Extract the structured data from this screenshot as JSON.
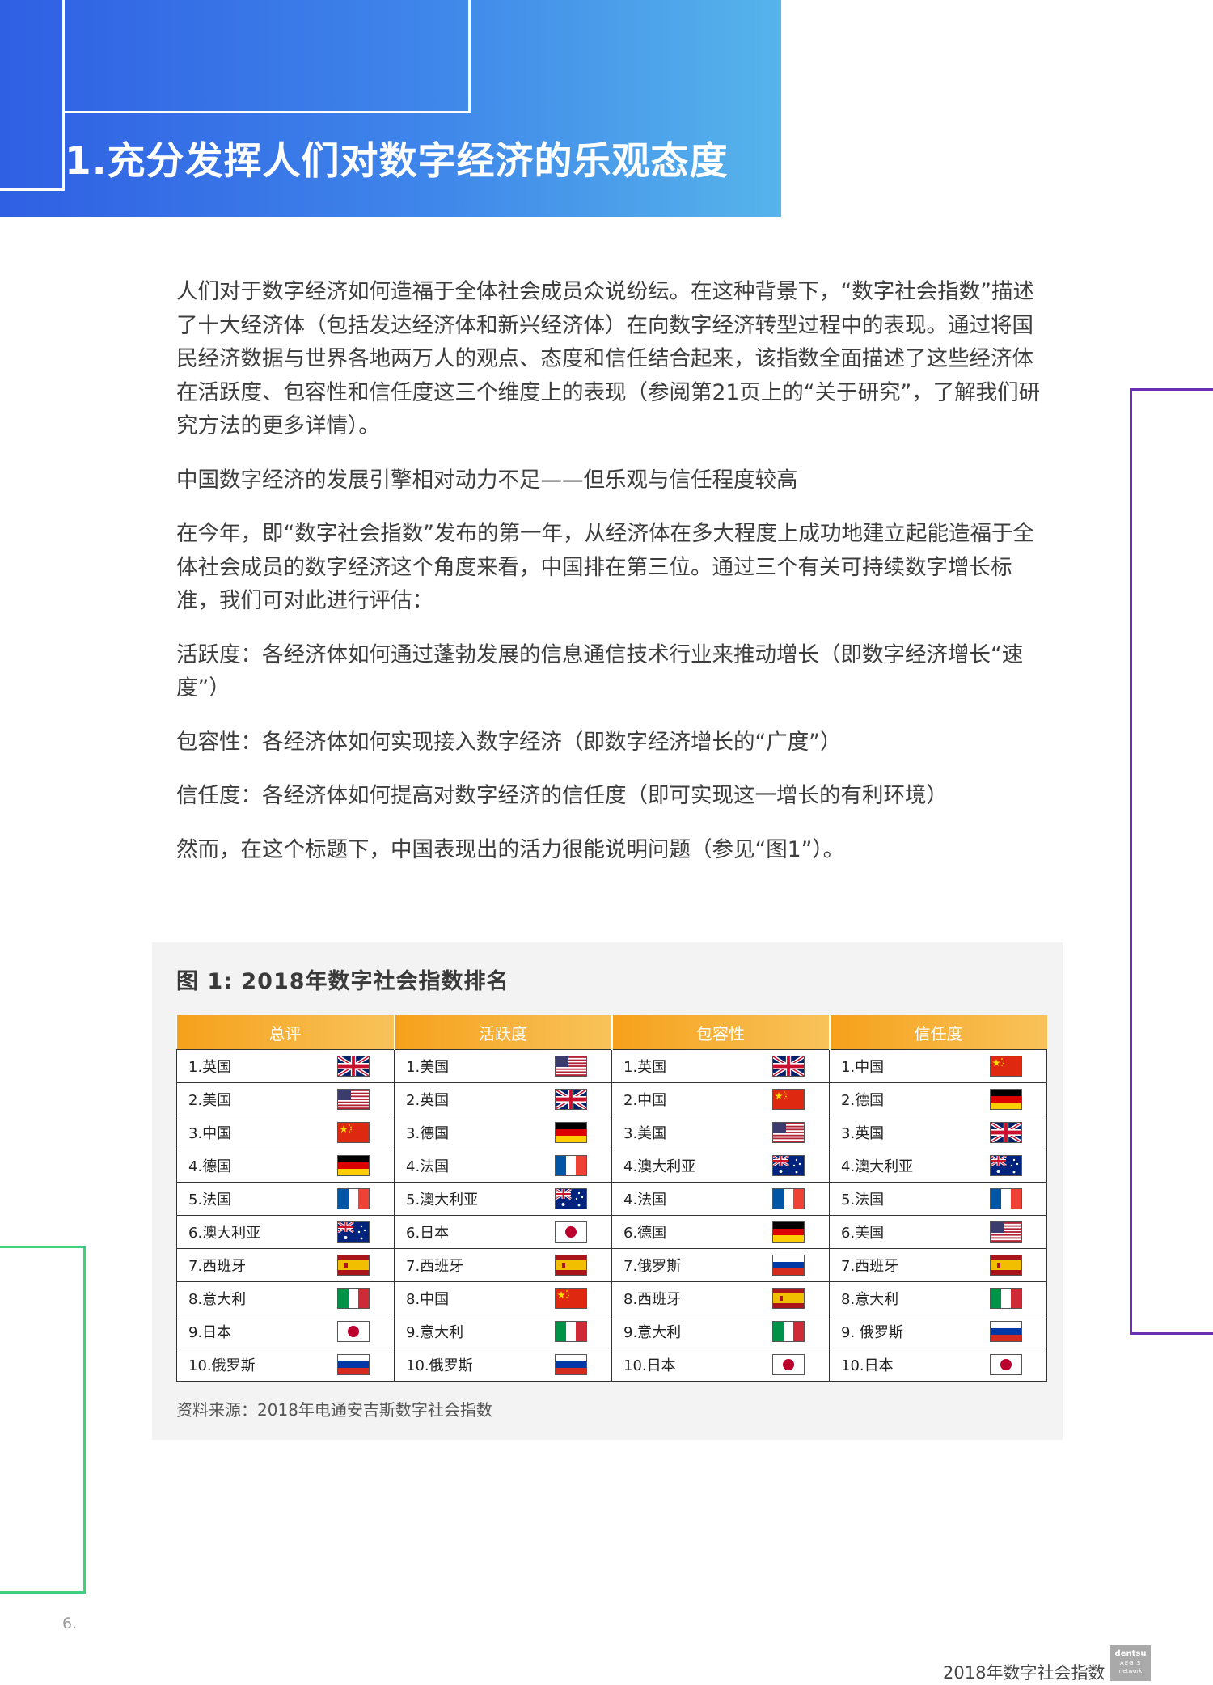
{
  "header": {
    "title": "1.充分发挥人们对数字经济的乐观态度"
  },
  "body": {
    "paragraphs": [
      "人们对于数字经济如何造福于全体社会成员众说纷纭。在这种背景下，“数字社会指数”描述了十大经济体（包括发达经济体和新兴经济体）在向数字经济转型过程中的表现。通过将国民经济数据与世界各地两万人的观点、态度和信任结合起来，该指数全面描述了这些经济体在活跃度、包容性和信任度这三个维度上的表现（参阅第21页上的“关于研究”，了解我们研究方法的更多详情）。",
      "中国数字经济的发展引擎相对动力不足——但乐观与信任程度较高",
      "在今年，即“数字社会指数”发布的第一年，从经济体在多大程度上成功地建立起能造福于全体社会成员的数字经济这个角度来看，中国排在第三位。通过三个有关可持续数字增长标准，我们可对此进行评估：",
      "活跃度：各经济体如何通过蓬勃发展的信息通信技术行业来推动增长（即数字经济增长“速度”）",
      "包容性：各经济体如何实现接入数字经济（即数字经济增长的“广度”）",
      "信任度：各经济体如何提高对数字经济的信任度（即可实现这一增长的有利环境）",
      "然而，在这个标题下，中国表现出的活力很能说明问题（参见“图1”）。"
    ]
  },
  "figure": {
    "title": "图 1: 2018年数字社会指数排名",
    "columns": [
      "总评",
      "活跃度",
      "包容性",
      "信任度"
    ],
    "rows": [
      [
        {
          "label": "1.英国",
          "flag": "uk"
        },
        {
          "label": "1.美国",
          "flag": "us"
        },
        {
          "label": "1.英国",
          "flag": "uk"
        },
        {
          "label": "1.中国",
          "flag": "cn"
        }
      ],
      [
        {
          "label": "2.美国",
          "flag": "us"
        },
        {
          "label": "2.英国",
          "flag": "uk"
        },
        {
          "label": "2.中国",
          "flag": "cn"
        },
        {
          "label": "2.德国",
          "flag": "de"
        }
      ],
      [
        {
          "label": "3.中国",
          "flag": "cn"
        },
        {
          "label": "3.德国",
          "flag": "de"
        },
        {
          "label": "3.美国",
          "flag": "us"
        },
        {
          "label": "3.英国",
          "flag": "uk"
        }
      ],
      [
        {
          "label": "4.德国",
          "flag": "de"
        },
        {
          "label": "4.法国",
          "flag": "fr"
        },
        {
          "label": "4.澳大利亚",
          "flag": "au"
        },
        {
          "label": "4.澳大利亚",
          "flag": "au"
        }
      ],
      [
        {
          "label": "5.法国",
          "flag": "fr"
        },
        {
          "label": "5.澳大利亚",
          "flag": "au"
        },
        {
          "label": "4.法国",
          "flag": "fr"
        },
        {
          "label": "5.法国",
          "flag": "fr"
        }
      ],
      [
        {
          "label": "6.澳大利亚",
          "flag": "au"
        },
        {
          "label": "6.日本",
          "flag": "jp"
        },
        {
          "label": "6.德国",
          "flag": "de"
        },
        {
          "label": "6.美国",
          "flag": "us"
        }
      ],
      [
        {
          "label": "7.西班牙",
          "flag": "es"
        },
        {
          "label": "7.西班牙",
          "flag": "es"
        },
        {
          "label": "7.俄罗斯",
          "flag": "ru"
        },
        {
          "label": "7.西班牙",
          "flag": "es"
        }
      ],
      [
        {
          "label": "8.意大利",
          "flag": "it"
        },
        {
          "label": "8.中国",
          "flag": "cn"
        },
        {
          "label": "8.西班牙",
          "flag": "es"
        },
        {
          "label": "8.意大利",
          "flag": "it"
        }
      ],
      [
        {
          "label": "9.日本",
          "flag": "jp"
        },
        {
          "label": "9.意大利",
          "flag": "it"
        },
        {
          "label": "9.意大利",
          "flag": "it"
        },
        {
          "label": "9. 俄罗斯",
          "flag": "ru"
        }
      ],
      [
        {
          "label": "10.俄罗斯",
          "flag": "ru"
        },
        {
          "label": "10.俄罗斯",
          "flag": "ru"
        },
        {
          "label": "10.日本",
          "flag": "jp"
        },
        {
          "label": "10.日本",
          "flag": "jp"
        }
      ]
    ],
    "source": "资料来源：2018年电通安吉斯数字社会指数"
  },
  "footer": {
    "page_number": "6.",
    "doc_title": "2018年数字社会指数",
    "logo_line1": "dentsu",
    "logo_line2": "AEGIS",
    "logo_line3": "network"
  }
}
